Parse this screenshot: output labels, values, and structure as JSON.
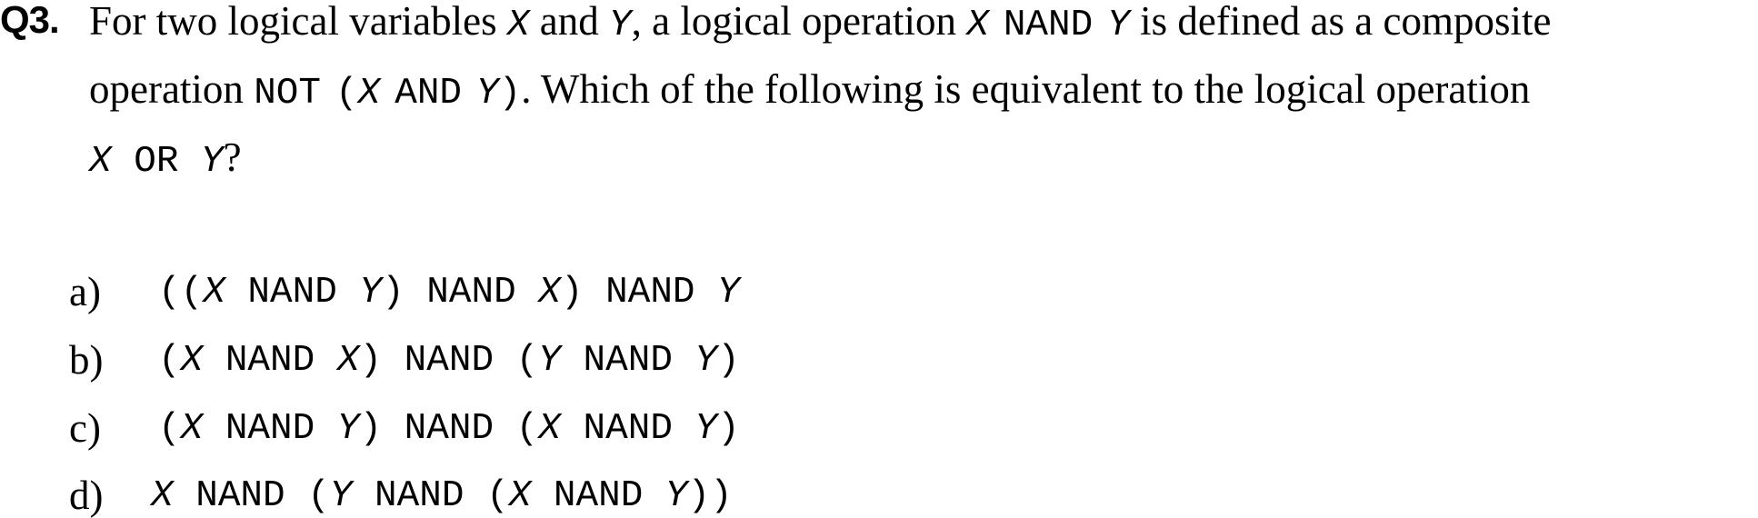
{
  "question": {
    "label": "Q3.",
    "line1": {
      "t1": "For two logical variables ",
      "v1": "X",
      "t2": " and ",
      "v2": "Y",
      "t3": ", a logical operation ",
      "v3": "X",
      "op": "NAND",
      "v4": "Y",
      "t4": " is defined as a composite"
    },
    "line2": {
      "t1": "operation ",
      "op1": "NOT",
      "paren_open": "(",
      "v1": "X",
      "op2": "AND",
      "v2": "Y",
      "paren_close": ")",
      "t2": ". Which of the following is equivalent to the logical operation"
    },
    "line3": {
      "v1": "X",
      "op": "OR",
      "v2": "Y",
      "t1": "?"
    }
  },
  "options": [
    {
      "letter": "a)",
      "expr": [
        "((",
        "X",
        " NAND ",
        "Y",
        ") NAND ",
        "X",
        ") NAND ",
        "Y",
        ""
      ]
    },
    {
      "letter": "b)",
      "expr": [
        "(",
        "X",
        " NAND ",
        "X",
        ") NAND (",
        "Y",
        " NAND ",
        "Y",
        ")"
      ]
    },
    {
      "letter": "c)",
      "expr": [
        "(",
        "X",
        " NAND ",
        "Y",
        ") NAND (",
        "X",
        " NAND ",
        "Y",
        ")"
      ]
    },
    {
      "letter": "d)",
      "expr": [
        "",
        "X",
        " NAND (",
        "Y",
        " NAND (",
        "X",
        " NAND ",
        "Y",
        "))"
      ]
    }
  ]
}
